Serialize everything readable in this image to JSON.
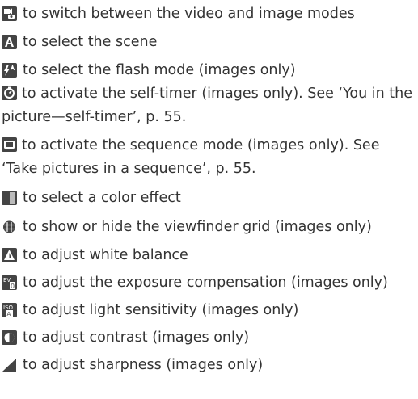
{
  "items": [
    {
      "icon": "switch-mode-icon",
      "text": "to switch between the video and image modes"
    },
    {
      "icon": "scene-icon",
      "text": "to select the scene"
    },
    {
      "icon": "flash-icon",
      "text": "to select the flash mode (images only)"
    },
    {
      "icon": "self-timer-icon",
      "text": "to activate the self-timer (images only). See ‘You in the picture—self-timer’, p. 55."
    },
    {
      "icon": "sequence-icon",
      "text": "to activate the sequence mode (images only). See ‘Take pictures in a sequence’, p. 55."
    },
    {
      "icon": "color-effect-icon",
      "text": "to select a color effect"
    },
    {
      "icon": "grid-icon",
      "text": "to show or hide the viewfinder grid (images only)"
    },
    {
      "icon": "white-balance-icon",
      "text": "to adjust white balance"
    },
    {
      "icon": "exposure-icon",
      "text": "to adjust the exposure compensation (images only)"
    },
    {
      "icon": "iso-icon",
      "text": "to adjust light sensitivity (images only)"
    },
    {
      "icon": "contrast-icon",
      "text": "to adjust contrast (images only)"
    },
    {
      "icon": "sharpness-icon",
      "text": "to adjust sharpness (images only)"
    }
  ],
  "colors": {
    "icon_bg": "#444444",
    "text": "#333333"
  }
}
